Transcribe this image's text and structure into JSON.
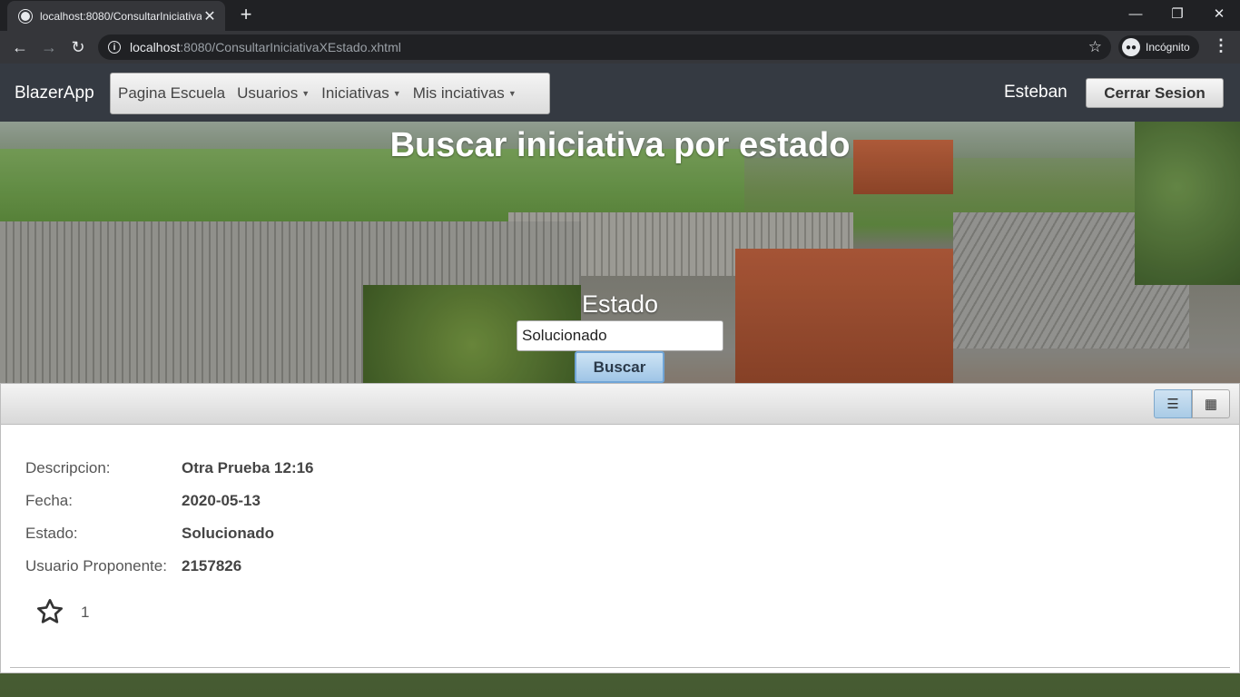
{
  "browser": {
    "tab_title": "localhost:8080/ConsultarIniciativaXEstado.xhtml",
    "url_host": "localhost",
    "url_rest": ":8080/ConsultarIniciativaXEstado.xhtml",
    "incognito_label": "Incógnito"
  },
  "navbar": {
    "brand": "BlazerApp",
    "menu": [
      {
        "label": "Pagina Escuela"
      },
      {
        "label": "Usuarios"
      },
      {
        "label": "Iniciativas"
      },
      {
        "label": "Mis inciativas"
      }
    ],
    "user_name": "Esteban",
    "logout_label": "Cerrar Sesion"
  },
  "main": {
    "title": "Buscar iniciativa por estado",
    "estado_label": "Estado",
    "estado_value": "Solucionado",
    "search_label": "Buscar"
  },
  "results": [
    {
      "fields": [
        {
          "label": "Descripcion:",
          "value": "Otra Prueba 12:16"
        },
        {
          "label": "Fecha:",
          "value": "2020-05-13"
        },
        {
          "label": "Estado:",
          "value": "Solucionado"
        },
        {
          "label": "Usuario Proponente:",
          "value": "2157826"
        }
      ],
      "likes": "1"
    }
  ],
  "colors": {
    "navbar_bg": "#353a42",
    "chrome_dark": "#202124",
    "chrome_toolbar": "#35363a",
    "active_layout": "#a9cbe6"
  }
}
